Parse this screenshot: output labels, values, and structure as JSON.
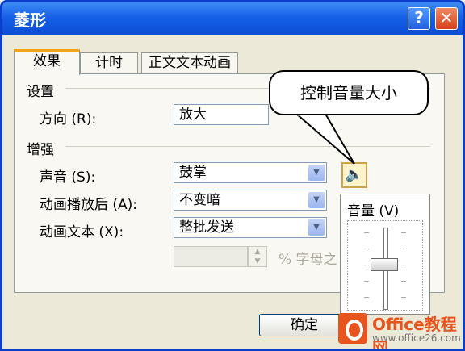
{
  "window": {
    "title": "菱形",
    "help_label": "?",
    "close_label": "✕"
  },
  "tabs": [
    "效果",
    "计时",
    "正文文本动画"
  ],
  "groups": {
    "settings": "设置",
    "enhance": "增强"
  },
  "settings": {
    "direction_label": "方向 (R):",
    "direction_value": "放大"
  },
  "enhance": {
    "sound_label": "声音 (S):",
    "sound_value": "鼓掌",
    "after_label": "动画播放后 (A):",
    "after_value": "不变暗",
    "text_label": "动画文本 (X):",
    "text_value": "整批发送",
    "delay_value": "",
    "delay_suffix": "% 字母之"
  },
  "volume": {
    "label": "音量 (V)",
    "level": 0.6
  },
  "callout": "控制音量大小",
  "buttons": {
    "ok": "确定"
  },
  "watermark": {
    "title": "Office教程网",
    "url": "www.office26.com"
  },
  "colors": {
    "titlebar": "#0b4ed4",
    "accent_tab": "#f6a518",
    "watermark": "#e8541e"
  },
  "icons": {
    "sound": "speaker-icon",
    "dropdown": "chevron-down-icon"
  }
}
